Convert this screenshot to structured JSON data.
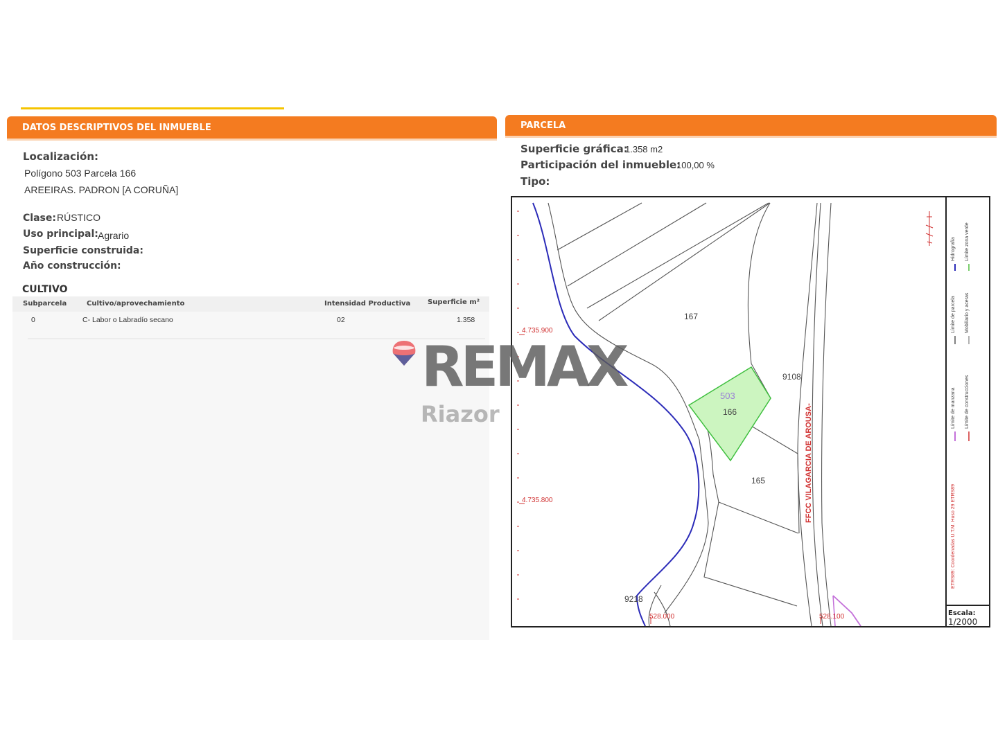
{
  "left_panel": {
    "header": "DATOS DESCRIPTIVOS DEL INMUEBLE",
    "localizacion_label": "Localización:",
    "localizacion_line1": "Polígono 503 Parcela 166",
    "localizacion_line2": "AREEIRAS. PADRON [A CORUÑA]",
    "clase_label": "Clase:",
    "clase_value": "RÚSTICO",
    "uso_label": "Uso principal:",
    "uso_value": "Agrario",
    "superficie_label": "Superficie construida:",
    "anio_label": "Año construcción:",
    "cultivo_title": "CULTIVO",
    "table": {
      "headers": [
        "Subparcela",
        "Cultivo/aprovechamiento",
        "Intensidad Productiva",
        "Superficie m²"
      ],
      "rows": [
        [
          "0",
          "C- Labor o Labradío secano",
          "02",
          "1.358"
        ]
      ]
    }
  },
  "right_panel": {
    "header": "PARCELA",
    "superficie_label": "Superficie gráfica:",
    "superficie_value": "1.358 m2",
    "participacion_label": "Participación del inmueble:",
    "participacion_value": "100,00 %",
    "tipo_label": "Tipo:"
  },
  "map": {
    "parcel_labels": [
      "167",
      "9108",
      "503",
      "166",
      "165",
      "9218"
    ],
    "coord_labels": [
      "4.735.900",
      "4.735.800",
      "528.000",
      "528.100"
    ],
    "road_label": "FFCC VILAGARCIA DE AROUSA-",
    "legend_items": [
      "Hidrografía",
      "Límite zona verde",
      "Límite de parcela",
      "Mobiliario y aceras",
      "Límite de manzana",
      "Límite de construcciones"
    ],
    "legend_footer": "ETRS89: Coordenadas U.T.M. Huso 29 ETRS89",
    "scale_label": "Escala:",
    "scale_value": "1/2000",
    "colors": {
      "parcel_fill": "#ccf5c0",
      "parcel_stroke": "#3fbf3f",
      "hydro": "#2b2bb8",
      "coord": "#d03030",
      "border_pink": "#c36fd9",
      "label_purple": "#9a7fd6"
    }
  },
  "watermark": {
    "brand": "REMAX",
    "sub": "Riazor"
  }
}
